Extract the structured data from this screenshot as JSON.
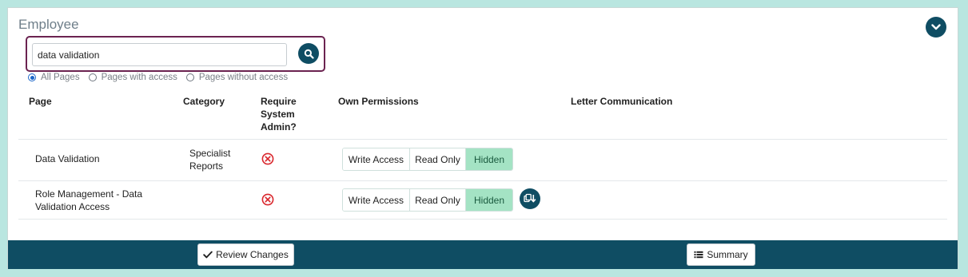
{
  "section": {
    "title": "Employee"
  },
  "search": {
    "value": "data validation"
  },
  "filters": [
    "All Pages",
    "Pages with access",
    "Pages without access"
  ],
  "filter_selected": "All Pages",
  "table": {
    "headers": {
      "page": "Page",
      "category": "Category",
      "require_admin": [
        "Require",
        "System",
        "Admin?"
      ],
      "own_permissions": "Own Permissions",
      "letter": "Letter Communication"
    },
    "rows": [
      {
        "page": [
          "Data Validation"
        ],
        "category": [
          "Specialist",
          "Reports"
        ],
        "require_admin_icon": "x-circle-icon",
        "permissions": [
          "Write Access",
          "Read Only",
          "Hidden"
        ],
        "selected": "Hidden"
      },
      {
        "page": [
          "Role Management - Data",
          "Validation Access"
        ],
        "category": [],
        "require_admin_icon": "x-circle-icon",
        "permissions": [
          "Write Access",
          "Read Only",
          "Hidden"
        ],
        "selected": "Hidden"
      }
    ]
  },
  "footer": {
    "review_label": "Review Changes",
    "summary_label": "Summary"
  },
  "colors": {
    "brand": "#0f4d63",
    "highlight_border": "#6b2350",
    "hidden_active": "#a4e3c4",
    "danger": "#d9262c",
    "background": "#b9e6e0"
  }
}
